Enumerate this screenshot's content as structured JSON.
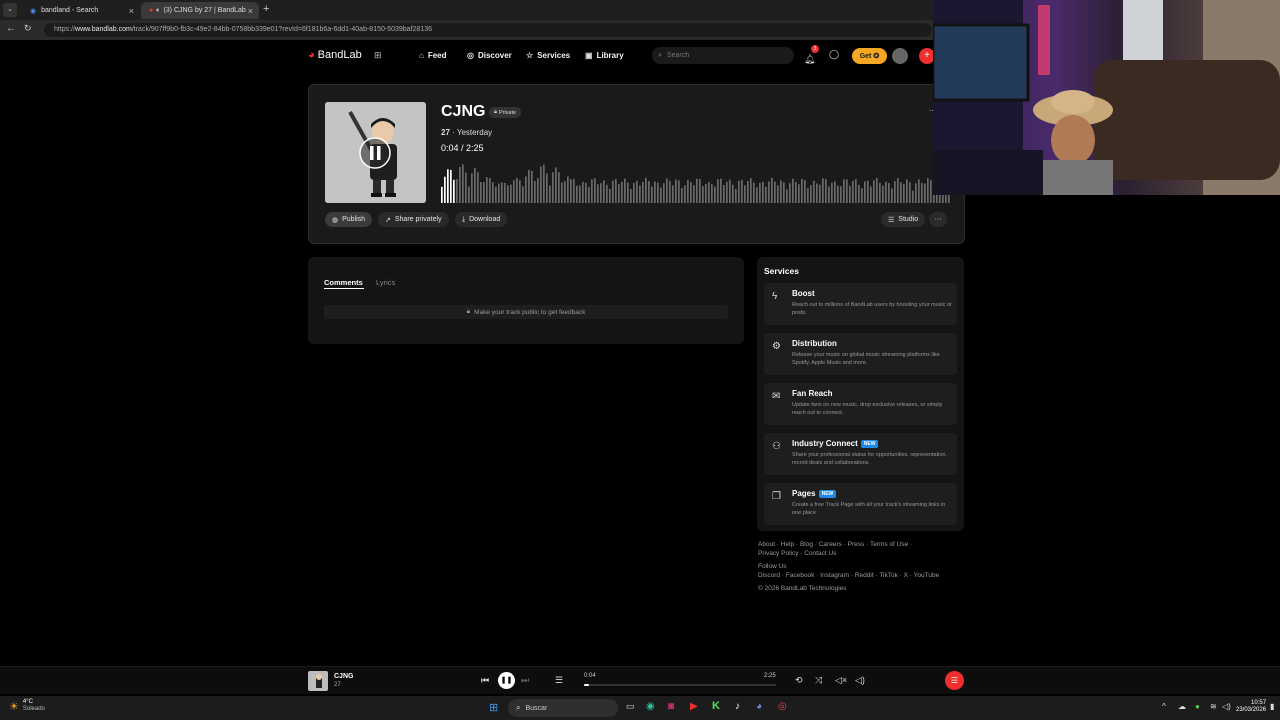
{
  "browser": {
    "tabs": [
      {
        "title": "bandland - Search",
        "active": false
      },
      {
        "title": "(3) CJNG by 27 | BandLab",
        "active": true
      }
    ],
    "url_prefix": "https://",
    "url_domain": "www.bandlab.com",
    "url_path": "/track/907ff9b0-fb3c-49e2-84bb-0758bb339e01?revId=6f181b6a-6dd1-40ab-8150-5039baf28136"
  },
  "header": {
    "logo": "BandLab",
    "nav": [
      {
        "label": "Feed",
        "icon": "home-icon"
      },
      {
        "label": "Discover",
        "icon": "compass-icon"
      },
      {
        "label": "Services",
        "icon": "star-icon"
      },
      {
        "label": "Library",
        "icon": "library-icon"
      }
    ],
    "search_placeholder": "Search",
    "get_label": "Get",
    "notification_count": "3"
  },
  "track": {
    "title": "CJNG",
    "visibility": "Private",
    "artist": "27",
    "date": "Yesterday",
    "current_time": "0:04",
    "duration": "2:25",
    "progress": 0.028,
    "actions": {
      "publish": "Publish",
      "share": "Share privately",
      "download": "Download",
      "studio": "Studio",
      "more": "···"
    }
  },
  "comments": {
    "tabs": [
      "Comments",
      "Lyrics"
    ],
    "notice": "Make your track public to get feedback"
  },
  "services": {
    "heading": "Services",
    "items": [
      {
        "title": "Boost",
        "badge": "",
        "desc": "Reach out to millions of BandLab users by boosting your music or posts.",
        "icon": "bolt-icon"
      },
      {
        "title": "Distribution",
        "badge": "",
        "desc": "Release your music on global music streaming platforms like Spotify, Apple Music and more.",
        "icon": "distribution-icon"
      },
      {
        "title": "Fan Reach",
        "badge": "",
        "desc": "Update fans on new music, drop exclusive releases, or simply reach out to connect.",
        "icon": "mail-icon"
      },
      {
        "title": "Industry Connect",
        "badge": "NEW",
        "desc": "Share your professional status for opportunities, representation, record deals and collaborations.",
        "icon": "people-icon"
      },
      {
        "title": "Pages",
        "badge": "NEW",
        "desc": "Create a free Track Page with all your track's streaming links in one place",
        "icon": "pages-icon"
      }
    ]
  },
  "footer": {
    "links_row1": [
      "About",
      "Help",
      "Blog",
      "Careers",
      "Press",
      "Terms of Use"
    ],
    "links_row2": [
      "Privacy Policy",
      "Contact Us"
    ],
    "follow_label": "Follow Us",
    "social": [
      "Discord",
      "Facebook",
      "Instagram",
      "Reddit",
      "TikTok",
      "X",
      "YouTube"
    ],
    "copyright": "© 2026 BandLab Technologies"
  },
  "player": {
    "title": "CJNG",
    "artist": "27",
    "current_time": "0:04",
    "duration": "2:25",
    "progress": 0.028
  },
  "taskbar": {
    "weather_temp": "4°C",
    "weather_desc": "Soleado",
    "search_label": "Buscar",
    "time": "10:57",
    "date": "23/03/2026"
  },
  "colors": {
    "accent_red": "#f02e2e",
    "get_button": "#f5a623",
    "new_badge": "#1e88e5"
  }
}
